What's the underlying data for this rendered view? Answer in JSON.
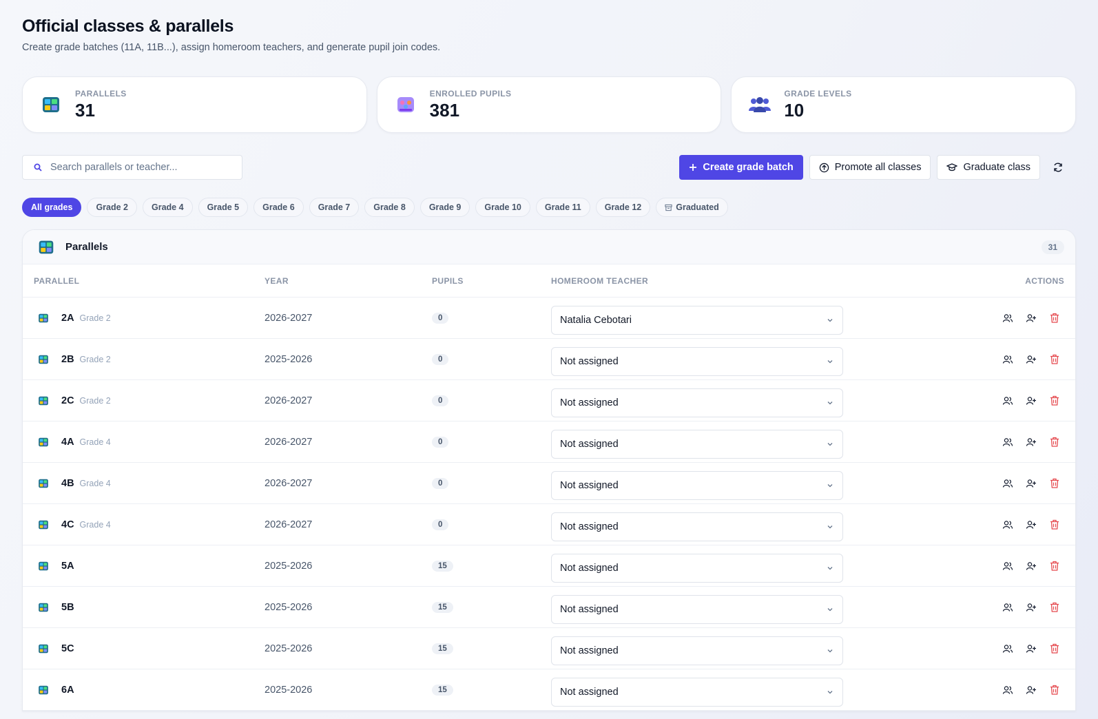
{
  "header": {
    "title": "Official classes & parallels",
    "subtitle": "Create grade batches (11A, 11B...), assign homeroom teachers, and generate pupil join codes."
  },
  "stats": [
    {
      "label": "PARALLELS",
      "value": "31",
      "icon": "class-board-icon"
    },
    {
      "label": "ENROLLED PUPILS",
      "value": "381",
      "icon": "pupils-icon"
    },
    {
      "label": "GRADE LEVELS",
      "value": "10",
      "icon": "people-group-icon"
    }
  ],
  "toolbar": {
    "search_placeholder": "Search parallels or teacher...",
    "create_label": "Create grade batch",
    "promote_label": "Promote all classes",
    "graduate_label": "Graduate class"
  },
  "filters": [
    "All grades",
    "Grade 2",
    "Grade 4",
    "Grade 5",
    "Grade 6",
    "Grade 7",
    "Grade 8",
    "Grade 9",
    "Grade 10",
    "Grade 11",
    "Grade 12",
    "Graduated"
  ],
  "panel": {
    "title": "Parallels",
    "count": "31",
    "columns": {
      "parallel": "PARALLEL",
      "year": "YEAR",
      "pupils": "PUPILS",
      "teacher": "HOMEROOM TEACHER",
      "actions": "ACTIONS"
    },
    "rows": [
      {
        "name": "2A",
        "grade": "Grade 2",
        "year": "2026-2027",
        "pupils": "0",
        "teacher": "Natalia Cebotari"
      },
      {
        "name": "2B",
        "grade": "Grade 2",
        "year": "2025-2026",
        "pupils": "0",
        "teacher": "Not assigned"
      },
      {
        "name": "2C",
        "grade": "Grade 2",
        "year": "2026-2027",
        "pupils": "0",
        "teacher": "Not assigned"
      },
      {
        "name": "4A",
        "grade": "Grade 4",
        "year": "2026-2027",
        "pupils": "0",
        "teacher": "Not assigned"
      },
      {
        "name": "4B",
        "grade": "Grade 4",
        "year": "2026-2027",
        "pupils": "0",
        "teacher": "Not assigned"
      },
      {
        "name": "4C",
        "grade": "Grade 4",
        "year": "2026-2027",
        "pupils": "0",
        "teacher": "Not assigned"
      },
      {
        "name": "5A",
        "grade": "",
        "year": "2025-2026",
        "pupils": "15",
        "teacher": "Not assigned"
      },
      {
        "name": "5B",
        "grade": "",
        "year": "2025-2026",
        "pupils": "15",
        "teacher": "Not assigned"
      },
      {
        "name": "5C",
        "grade": "",
        "year": "2025-2026",
        "pupils": "15",
        "teacher": "Not assigned"
      },
      {
        "name": "6A",
        "grade": "",
        "year": "2025-2026",
        "pupils": "15",
        "teacher": "Not assigned"
      }
    ]
  },
  "colors": {
    "accent": "#4f46e5",
    "danger": "#e5484d",
    "text": "#0f172a",
    "muted": "#64748b"
  }
}
